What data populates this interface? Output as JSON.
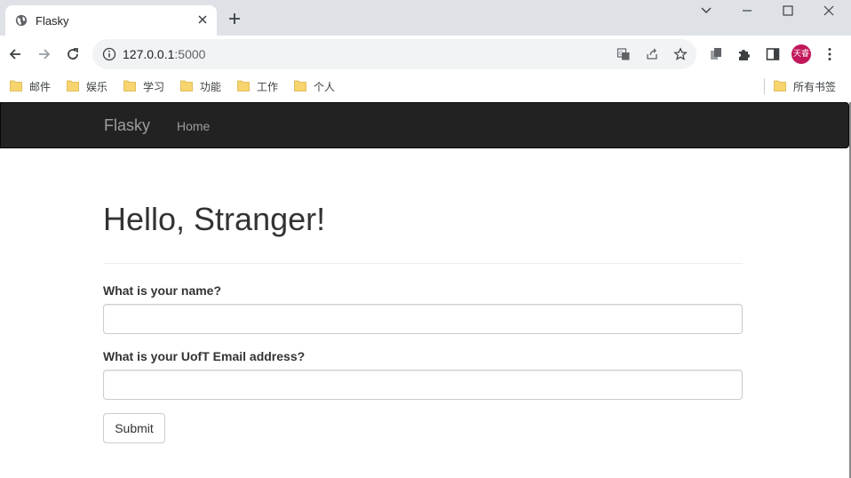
{
  "browser": {
    "tab": {
      "title": "Flasky"
    },
    "address": {
      "host": "127.0.0.1",
      "port": ":5000"
    },
    "bookmarks": [
      "邮件",
      "娱乐",
      "学习",
      "功能",
      "工作",
      "个人"
    ],
    "all_bookmarks_label": "所有书签",
    "profile_initials": "天睿",
    "profile_color": "#c2185b"
  },
  "navbar": {
    "brand": "Flasky",
    "links": [
      "Home"
    ]
  },
  "page": {
    "heading": "Hello, Stranger!",
    "form": {
      "name_label": "What is your name?",
      "name_value": "",
      "email_label": "What is your UofT Email address?",
      "email_value": "",
      "submit_label": "Submit"
    }
  },
  "colors": {
    "navbar_bg": "#222222",
    "navbar_text": "#9d9d9d",
    "tabstrip_bg": "#dee1e6",
    "omnibox_bg": "#f1f3f4"
  }
}
